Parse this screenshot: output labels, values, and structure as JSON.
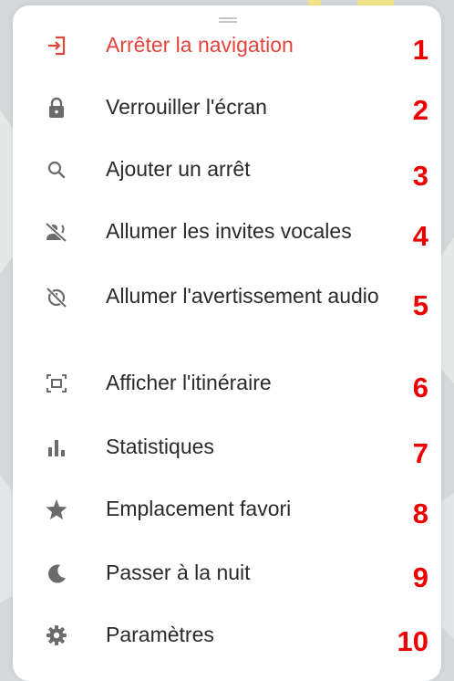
{
  "menu": {
    "items": [
      {
        "label": "Arrêter la navigation",
        "number": "1",
        "icon": "exit-icon"
      },
      {
        "label": "Verrouiller l'écran",
        "number": "2",
        "icon": "lock-icon"
      },
      {
        "label": "Ajouter un arrêt",
        "number": "3",
        "icon": "search-icon"
      },
      {
        "label": "Allumer les invites vocales",
        "number": "4",
        "icon": "voice-off-icon"
      },
      {
        "label": "Allumer l'avertissement audio",
        "number": "5",
        "icon": "alert-off-icon"
      },
      {
        "label": "Afficher l'itinéraire",
        "number": "6",
        "icon": "route-overview-icon"
      },
      {
        "label": "Statistiques",
        "number": "7",
        "icon": "bar-chart-icon"
      },
      {
        "label": "Emplacement favori",
        "number": "8",
        "icon": "star-icon"
      },
      {
        "label": "Passer à la nuit",
        "number": "9",
        "icon": "moon-icon"
      },
      {
        "label": "Paramètres",
        "number": "10",
        "icon": "gear-icon"
      }
    ]
  },
  "colors": {
    "accent_red": "#e5443b",
    "annotation_red": "#ee0000",
    "icon_gray": "#6b6b6b"
  }
}
